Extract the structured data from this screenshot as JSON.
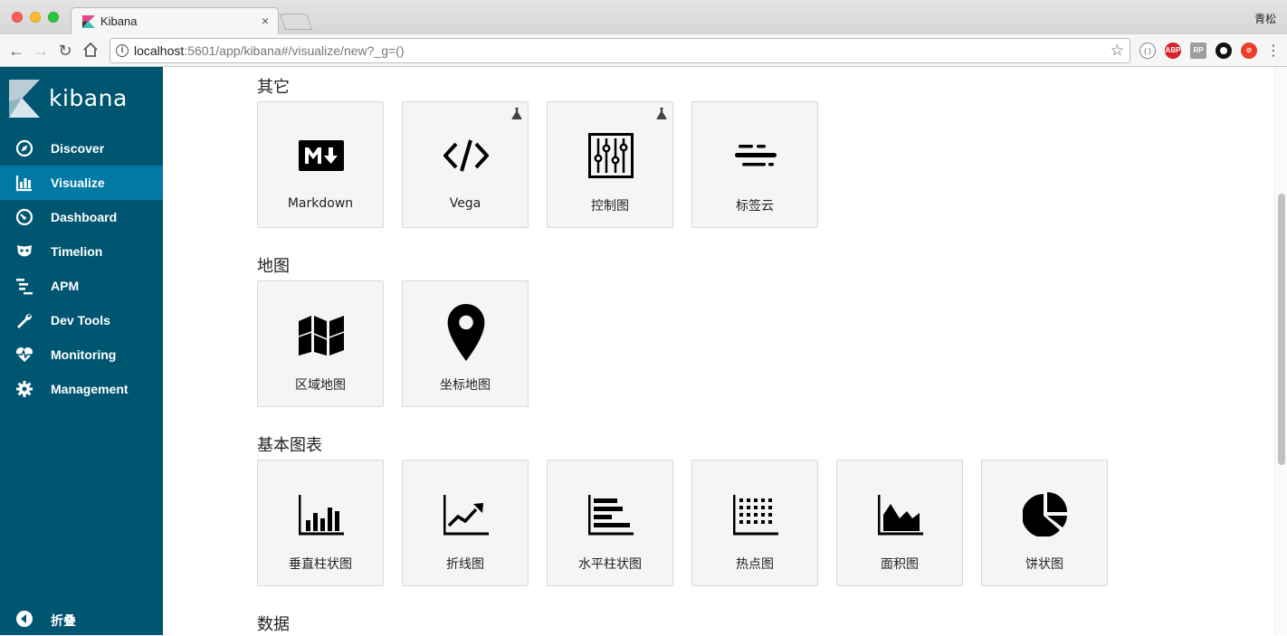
{
  "browser": {
    "tab_title": "Kibana",
    "tab_close": "×",
    "profile_name": "青松",
    "url_host": "localhost",
    "url_rest": ":5601/app/kibana#/visualize/new?_g=()",
    "ext_abp": "ABP",
    "ext_rp": "RP"
  },
  "sidebar": {
    "logo_text": "kibana",
    "items": [
      {
        "label": "Discover",
        "icon": "compass-icon"
      },
      {
        "label": "Visualize",
        "icon": "bar-chart-icon",
        "active": true
      },
      {
        "label": "Dashboard",
        "icon": "dashboard-gauge-icon"
      },
      {
        "label": "Timelion",
        "icon": "timelion-mask-icon"
      },
      {
        "label": "APM",
        "icon": "apm-lines-icon"
      },
      {
        "label": "Dev Tools",
        "icon": "wrench-icon"
      },
      {
        "label": "Monitoring",
        "icon": "heartbeat-icon"
      },
      {
        "label": "Management",
        "icon": "gear-icon"
      }
    ],
    "collapse_label": "折叠"
  },
  "sections": {
    "other": {
      "title": "其它",
      "cards": [
        {
          "label": "Markdown",
          "icon": "markdown-icon",
          "beta": false
        },
        {
          "label": "Vega",
          "icon": "code-icon",
          "beta": true
        },
        {
          "label": "控制图",
          "icon": "controls-sliders-icon",
          "beta": true
        },
        {
          "label": "标签云",
          "icon": "tag-cloud-icon",
          "beta": false
        }
      ]
    },
    "maps": {
      "title": "地图",
      "cards": [
        {
          "label": "区域地图",
          "icon": "region-map-icon"
        },
        {
          "label": "坐标地图",
          "icon": "map-pin-icon"
        }
      ]
    },
    "basic": {
      "title": "基本图表",
      "cards": [
        {
          "label": "垂直柱状图",
          "icon": "vertical-bar-icon"
        },
        {
          "label": "折线图",
          "icon": "line-chart-icon"
        },
        {
          "label": "水平柱状图",
          "icon": "horizontal-bar-icon"
        },
        {
          "label": "热点图",
          "icon": "heatmap-icon"
        },
        {
          "label": "面积图",
          "icon": "area-chart-icon"
        },
        {
          "label": "饼状图",
          "icon": "pie-chart-icon"
        }
      ]
    },
    "data": {
      "title": "数据"
    }
  },
  "colors": {
    "sidebar_bg": "#005571",
    "sidebar_active": "#0079a5",
    "card_bg": "#f5f5f5"
  }
}
